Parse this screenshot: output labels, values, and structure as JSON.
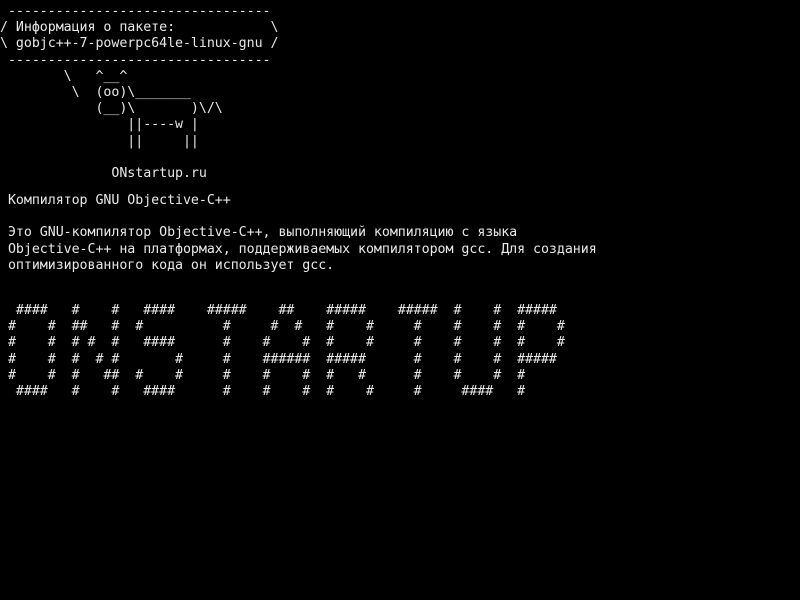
{
  "screen": {
    "background": "#000000",
    "text_color": "#e8e8e8"
  },
  "cowsay": {
    "lines": [
      " ---------------------------------",
      "/ Информация о пакете:            \\",
      "\\ gobjc++-7-powerpc64le-linux-gnu /",
      " ---------------------------------",
      "        \\   ^__^",
      "         \\  (oo)\\_______",
      "            (__)\\       )\\/\\",
      "                ||----w |",
      "                ||     ||",
      "",
      "              ONstartup.ru"
    ]
  },
  "description": {
    "title": " Компилятор GNU Objective-C++",
    "body": [
      " Это GNU-компилятор Objective-C++, выполняющий компиляцию с языка",
      " Objective-C++ на платформах, поддерживаемых компилятором gcc. Для создания",
      " оптимизированного кода он использует gcc."
    ]
  },
  "banner": {
    "lines": [
      "  ####   #    #   ####    #####    ##    #####    #####  #    #  #####",
      " #    #  ##   #  #          #     #  #   #    #     #    #    #  #    #",
      " #    #  # #  #   ####      #    #    #  #    #     #    #    #  #    #",
      " #    #  #  # #       #     #    ######  #####      #    #    #  #####",
      " #    #  #   ##  #    #     #    #    #  #   #      #    #    #  #",
      "  ####   #    #   ####      #    #    #  #    #     #     ####   #"
    ]
  }
}
